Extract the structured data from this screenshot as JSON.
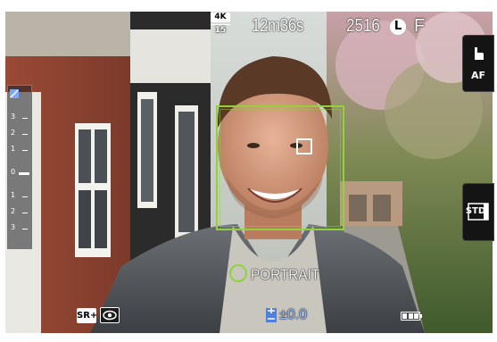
{
  "viewfinder": {
    "resolution_top": "4K",
    "resolution_bottom": "15",
    "recording_time": "12m36s",
    "frames_remaining": "2516",
    "image_size": "L",
    "image_quality": "F",
    "af_button_label": "AF",
    "style_button_label": "STD",
    "scene_mode": "PORTRAIT",
    "sr_badge": "SR+",
    "exposure_compensation": "±0.0",
    "battery_bars": 3,
    "scale_labels": [
      "3",
      "2",
      "1",
      "0",
      "1",
      "2",
      "3"
    ],
    "face_frame_color": "#8fd23c",
    "exposure_value_color": "#8fb8ff"
  }
}
